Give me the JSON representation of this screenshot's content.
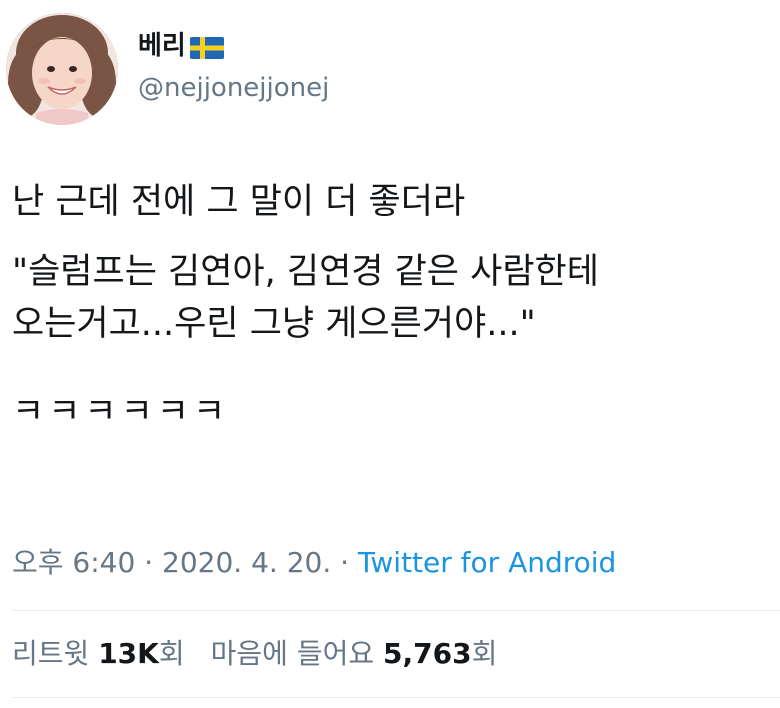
{
  "user": {
    "display_name": "베리",
    "flag_icon": "sweden-flag-icon",
    "handle": "@nejjonejjonej"
  },
  "tweet": {
    "line1": "난 근데 전에 그 말이 더 좋더라",
    "line2": "\"슬럼프는 김연아, 김연경 같은 사람한테",
    "line3": "오는거고...우린 그냥 게으른거야...\"",
    "line4": "ㅋㅋㅋㅋㅋㅋ"
  },
  "meta": {
    "time": "오후 6:40",
    "separator1": " · ",
    "date": "2020. 4. 20.",
    "separator2": " · ",
    "app": "Twitter for Android"
  },
  "stats": {
    "retweets_label": "리트윗 ",
    "retweets_count": "13K",
    "retweets_unit": "회",
    "likes_label": "마음에 들어요 ",
    "likes_count": "5,763",
    "likes_unit": "회"
  },
  "colors": {
    "text": "#14171a",
    "secondary": "#657786",
    "link": "#1b95e0",
    "divider": "#e6ecf0"
  }
}
